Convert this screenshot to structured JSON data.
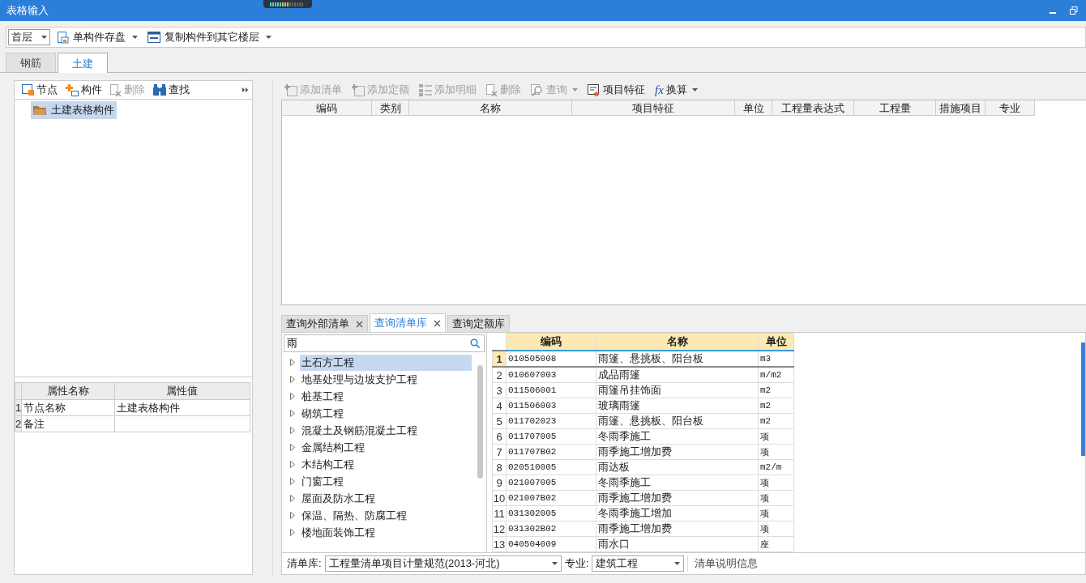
{
  "window": {
    "title": "表格输入"
  },
  "toolbar": {
    "floor": "首层",
    "buttons": [
      {
        "label": "单构件存盘",
        "kind": "save",
        "dropdown": true
      },
      {
        "label": "复制构件到其它楼层",
        "kind": "copy",
        "dropdown": true
      }
    ]
  },
  "tabs": [
    {
      "label": "钢筋",
      "selected": false
    },
    {
      "label": "土建",
      "selected": true
    }
  ],
  "left_toolbar": [
    {
      "label": "节点",
      "kind": "node",
      "disabled": false
    },
    {
      "label": "构件",
      "kind": "part",
      "disabled": false
    },
    {
      "label": "删除",
      "kind": "delete",
      "disabled": true
    },
    {
      "label": "查找",
      "kind": "find",
      "disabled": false
    }
  ],
  "tree": [
    {
      "label": "土建表格构件",
      "selected": true
    }
  ],
  "properties": {
    "columns": [
      "属性名称",
      "属性值"
    ],
    "rows": [
      {
        "index": "1",
        "name": "节点名称",
        "value": "土建表格构件"
      },
      {
        "index": "2",
        "name": "备注"
      }
    ]
  },
  "list_toolbar": [
    {
      "label": "添加清单",
      "kind": "add",
      "disabled": true,
      "dropdown": false
    },
    {
      "label": "添加定额",
      "kind": "add",
      "disabled": true,
      "dropdown": false
    },
    {
      "label": "添加明细",
      "kind": "detail",
      "disabled": true,
      "dropdown": false
    },
    {
      "label": "删除",
      "kind": "delete",
      "disabled": true,
      "dropdown": false
    },
    {
      "label": "查询",
      "kind": "query",
      "disabled": true,
      "dropdown": true
    },
    {
      "label": "项目特征",
      "kind": "feature",
      "disabled": false,
      "dropdown": false
    },
    {
      "label": "换算",
      "kind": "fx",
      "disabled": false,
      "dropdown": true
    }
  ],
  "list_table": {
    "columns": [
      "编码",
      "类别",
      "名称",
      "项目特征",
      "单位",
      "工程量表达式",
      "工程量",
      "措施项目",
      "专业"
    ]
  },
  "query_tabs": [
    {
      "label": "查询外部清单",
      "selected": false,
      "closable": true
    },
    {
      "label": "查询清单库",
      "selected": true,
      "closable": true
    },
    {
      "label": "查询定额库",
      "selected": false,
      "closable": false
    }
  ],
  "search": {
    "value": "雨"
  },
  "categories": [
    {
      "label": "土石方工程",
      "selected": true
    },
    {
      "label": "地基处理与边坡支护工程",
      "selected": false
    },
    {
      "label": "桩基工程",
      "selected": false
    },
    {
      "label": "砌筑工程",
      "selected": false
    },
    {
      "label": "混凝土及钢筋混凝土工程",
      "selected": false
    },
    {
      "label": "金属结构工程",
      "selected": false
    },
    {
      "label": "木结构工程",
      "selected": false
    },
    {
      "label": "门窗工程",
      "selected": false
    },
    {
      "label": "屋面及防水工程",
      "selected": false
    },
    {
      "label": "保温、隔热、防腐工程",
      "selected": false
    },
    {
      "label": "楼地面装饰工程",
      "selected": false
    }
  ],
  "results": {
    "columns": [
      "编码",
      "名称",
      "单位"
    ],
    "rows": [
      {
        "index": "1",
        "code": "010505008",
        "name": "雨篷、悬挑板、阳台板",
        "unit": "m3",
        "selected": true
      },
      {
        "index": "2",
        "code": "010607003",
        "name": "成品雨篷",
        "unit": "m/m2",
        "selected": false
      },
      {
        "index": "3",
        "code": "011506001",
        "name": "雨篷吊挂饰面",
        "unit": "m2",
        "selected": false
      },
      {
        "index": "4",
        "code": "011506003",
        "name": "玻璃雨篷",
        "unit": "m2",
        "selected": false
      },
      {
        "index": "5",
        "code": "011702023",
        "name": "雨篷、悬挑板、阳台板",
        "unit": "m2",
        "selected": false
      },
      {
        "index": "6",
        "code": "011707005",
        "name": "冬雨季施工",
        "unit": "项",
        "selected": false
      },
      {
        "index": "7",
        "code": "011707B02",
        "name": "雨季施工增加费",
        "unit": "项",
        "selected": false
      },
      {
        "index": "8",
        "code": "020510005",
        "name": "雨达板",
        "unit": "m2/m",
        "selected": false
      },
      {
        "index": "9",
        "code": "021007005",
        "name": "冬雨季施工",
        "unit": "项",
        "selected": false
      },
      {
        "index": "10",
        "code": "021007B02",
        "name": "雨季施工增加费",
        "unit": "项",
        "selected": false
      },
      {
        "index": "11",
        "code": "031302005",
        "name": "冬雨季施工增加",
        "unit": "项",
        "selected": false
      },
      {
        "index": "12",
        "code": "031302B02",
        "name": "雨季施工增加费",
        "unit": "项",
        "selected": false
      },
      {
        "index": "13",
        "code": "040504009",
        "name": "雨水口",
        "unit": "座",
        "selected": false
      }
    ]
  },
  "footer": {
    "library_label": "清单库:",
    "library": "工程量清单项目计量规范(2013-河北)",
    "specialty_label": "专业:",
    "specialty": "建筑工程",
    "info_button": "清单说明信息"
  }
}
